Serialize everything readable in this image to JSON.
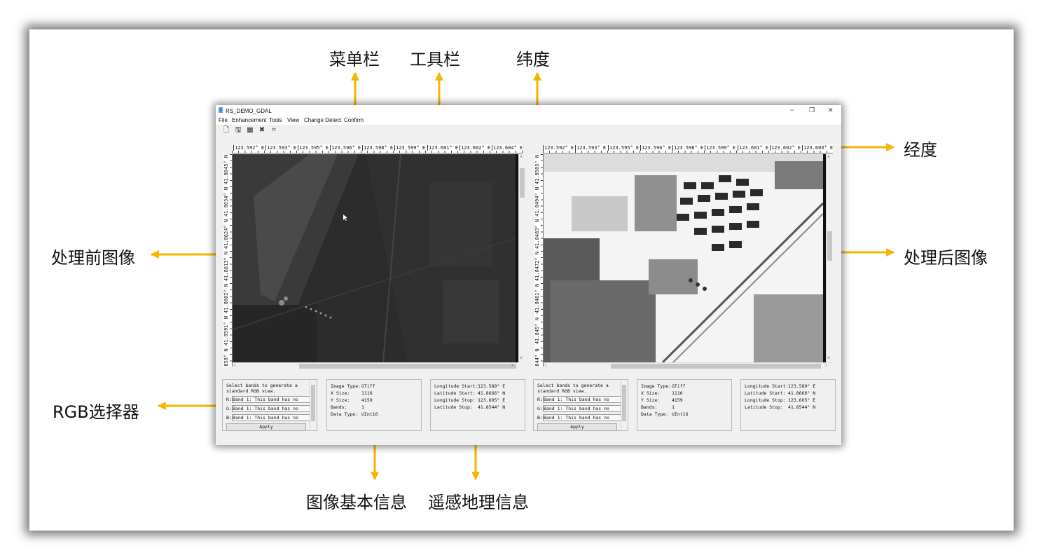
{
  "callouts": {
    "menubar": "菜单栏",
    "toolbar": "工具栏",
    "latitude": "纬度",
    "longitude": "经度",
    "before": "处理前图像",
    "after": "处理后图像",
    "rgb": "RGB选择器",
    "basic_info": "图像基本信息",
    "geo_info": "遥感地理信息"
  },
  "colors": {
    "arrow": "#f5b400",
    "window_bg": "#f0f0f0"
  },
  "window": {
    "title": "RS_DEMO_GDAL",
    "controls": {
      "minimize": "−",
      "restore": "❐",
      "close": "✕"
    }
  },
  "menu": [
    "File",
    "Enhancement",
    "Tools",
    "View",
    "Change Detect",
    "Confirm"
  ],
  "toolbar_icons": [
    "open-icon",
    "save-icon",
    "grid-icon",
    "compress-icon",
    "crop-icon"
  ],
  "left_view": {
    "lon_ticks": [
      "123.592° E",
      "123.593° E",
      "123.595° E",
      "123.596° E",
      "123.598° E",
      "123.599° E",
      "123.601° E",
      "123.602° E",
      "123.604° E"
    ],
    "lat_ticks": [
      "41.8645° N",
      "41.8634° N",
      "41.8624° N",
      "41.8613° N",
      "41.8602° N",
      "41.8591° N",
      "858° N"
    ]
  },
  "right_view": {
    "lon_ticks": [
      "123.592° E",
      "123.593° E",
      "123.595° E",
      "123.596° E",
      "123.598° E",
      "123.599° E",
      "123.601° E",
      "123.602° E",
      "123.603° E"
    ],
    "lat_ticks": [
      "41.8505° N",
      "41.8494° N",
      "41.8483° N",
      "41.8472° N",
      "41.8461° N",
      "41.845° N",
      "844° N"
    ]
  },
  "rgb_selector": {
    "instruction": "Select bands to generate a standard RGB view.",
    "rows": [
      {
        "label": "R:",
        "value": "Band 1: This band has no"
      },
      {
        "label": "G:",
        "value": "Band 1: This band has no"
      },
      {
        "label": "B:",
        "value": "Band 1: This band has no"
      }
    ],
    "apply_label": "Apply"
  },
  "image_info": [
    {
      "key": "Image Type:",
      "value": "GTiff"
    },
    {
      "key": "X Size:",
      "value": "1116"
    },
    {
      "key": "Y Size:",
      "value": "4159"
    },
    {
      "key": "Bands:",
      "value": "1"
    },
    {
      "key": "Data Type:",
      "value": "UInt16"
    }
  ],
  "geo_info": [
    {
      "key": "Longitude Start:",
      "value": "123.589° E"
    },
    {
      "key": "Latitude Start:",
      "value": "41.8666° N"
    },
    {
      "key": "Longitude Stop:",
      "value": "123.605° E"
    },
    {
      "key": "Latitude Stop:",
      "value": "41.8544° N"
    }
  ]
}
